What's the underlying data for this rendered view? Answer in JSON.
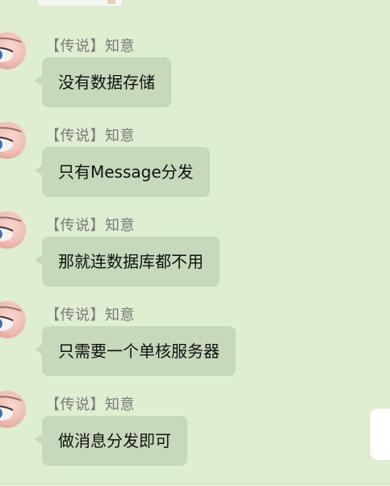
{
  "messages": [
    {
      "sender": "【传说】知意",
      "text": "没有数据存储"
    },
    {
      "sender": "【传说】知意",
      "text": "只有Message分发"
    },
    {
      "sender": "【传说】知意",
      "text": "那就连数据库都不用"
    },
    {
      "sender": "【传说】知意",
      "text": "只需要一个单核服务器"
    },
    {
      "sender": "【传说】知意",
      "text": "做消息分发即可"
    }
  ],
  "colors": {
    "background": "#dfedd0",
    "bubble": "#c8d8ba",
    "sender_text": "#7a7a7a"
  }
}
